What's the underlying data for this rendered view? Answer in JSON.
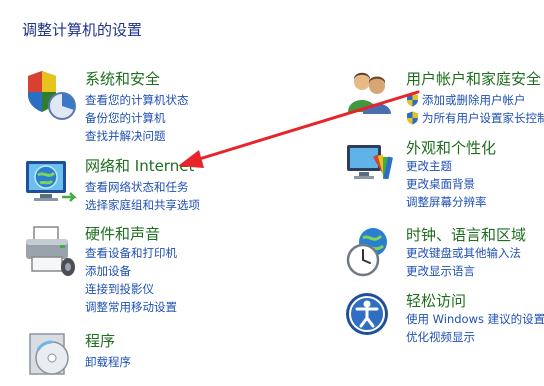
{
  "page": {
    "title": "调整计算机的设置"
  },
  "categories": {
    "system": {
      "title": "系统和安全",
      "links": [
        "查看您的计算机状态",
        "备份您的计算机",
        "查找并解决问题"
      ]
    },
    "network": {
      "title": "网络和 Internet",
      "links": [
        "查看网络状态和任务",
        "选择家庭组和共享选项"
      ]
    },
    "hardware": {
      "title": "硬件和声音",
      "links": [
        "查看设备和打印机",
        "添加设备",
        "连接到投影仪",
        "调整常用移动设置"
      ]
    },
    "programs": {
      "title": "程序",
      "links": [
        "卸载程序"
      ]
    },
    "users": {
      "title": "用户帐户和家庭安全",
      "links": [
        "添加或删除用户帐户",
        "为所有用户设置家长控制"
      ]
    },
    "appearance": {
      "title": "外观和个性化",
      "links": [
        "更改主题",
        "更改桌面背景",
        "调整屏幕分辨率"
      ]
    },
    "clock": {
      "title": "时钟、语言和区域",
      "links": [
        "更改键盘或其他输入法",
        "更改显示语言"
      ]
    },
    "ease": {
      "title": "轻松访问",
      "links": [
        "使用 Windows 建议的设置",
        "优化视频显示"
      ]
    }
  },
  "colors": {
    "title_text": "#1e3287",
    "category_title": "#1e6e1e",
    "link_text": "#1f50b4",
    "annotation_arrow": "#e8232a"
  },
  "icons": {
    "system": "shield-chart-icon",
    "network": "globe-monitor-icon",
    "hardware": "printer-icon",
    "programs": "disc-icon",
    "users": "two-users-icon",
    "appearance": "monitor-palette-icon",
    "clock": "clock-globe-icon",
    "ease": "accessibility-icon"
  }
}
